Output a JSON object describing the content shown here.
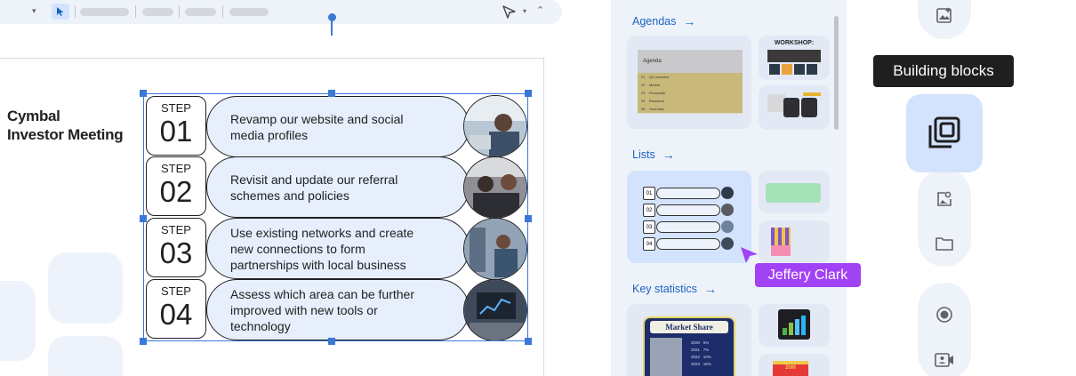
{
  "slide": {
    "brand_name": "Cymbal",
    "brand_subtitle": "Investor Meeting",
    "steps": [
      {
        "label": "STEP",
        "number": "01",
        "text": "Revamp our website and social media profiles"
      },
      {
        "label": "STEP",
        "number": "02",
        "text": "Revisit and update our referral schemes and policies"
      },
      {
        "label": "STEP",
        "number": "03",
        "text": "Use existing networks and create new connections to form partnerships with local business"
      },
      {
        "label": "STEP",
        "number": "04",
        "text": "Assess which area can be further improved with new tools or technology"
      }
    ]
  },
  "panel": {
    "sections": [
      {
        "title": "Agendas",
        "arrow": "→"
      },
      {
        "title": "Lists",
        "arrow": "→"
      },
      {
        "title": "Key statistics",
        "arrow": "→"
      }
    ],
    "agenda_thumb": {
      "title": "Agenda",
      "rows": [
        {
          "num": "01",
          "label": "Q3 overview"
        },
        {
          "num": "02",
          "label": "Market"
        },
        {
          "num": "03",
          "label": "Financials"
        },
        {
          "num": "04",
          "label": "Research"
        },
        {
          "num": "05",
          "label": "Overview"
        }
      ]
    },
    "workshop_thumb": {
      "title": "WORKSHOP:"
    },
    "list_thumb_steps": [
      "01",
      "02",
      "03",
      "04"
    ],
    "market_thumb": {
      "title": "Market Share",
      "rows": [
        {
          "year": "2020",
          "value": "5%"
        },
        {
          "year": "2021",
          "value": "7%"
        },
        {
          "year": "2022",
          "value": "10%"
        },
        {
          "year": "2023",
          "value": "15%"
        }
      ]
    },
    "sticker_text": "20M"
  },
  "tooltip": "Building blocks",
  "collaborator": "Jeffery Clark",
  "icons": {
    "rail": [
      "image-sparkle-icon",
      "building-blocks-icon",
      "image-search-icon",
      "folder-icon",
      "record-icon",
      "video-person-icon"
    ]
  },
  "colors": {
    "accent": "#1a63c4",
    "selection": "#3b78d8",
    "rail_active": "#d3e3fd",
    "collaborator": "#a142f4"
  }
}
